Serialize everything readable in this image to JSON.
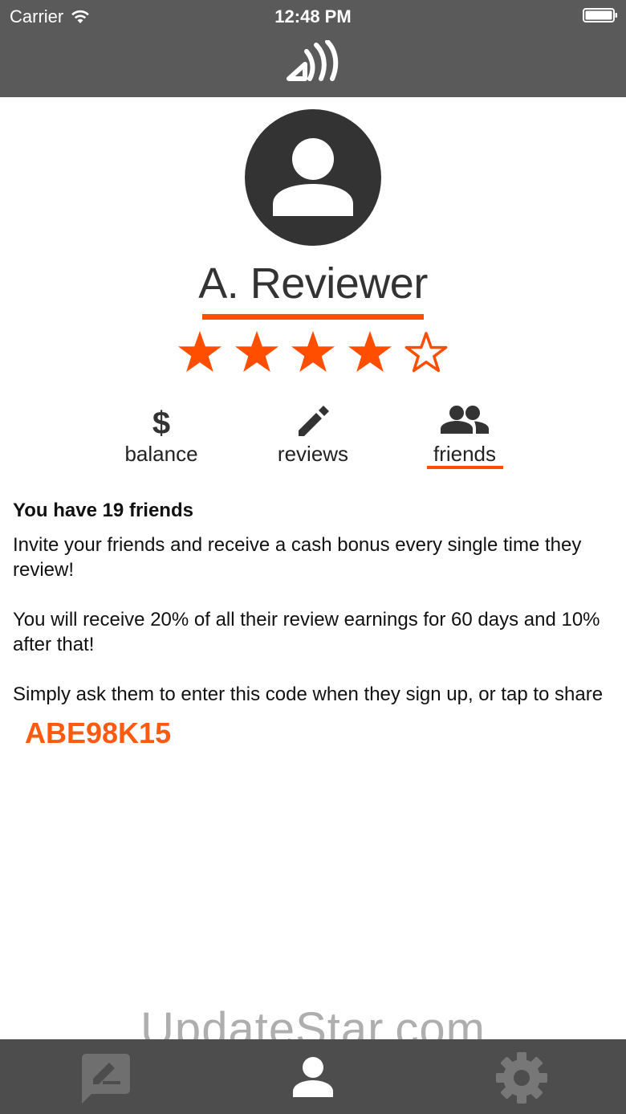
{
  "status_bar": {
    "carrier": "Carrier",
    "time": "12:48 PM"
  },
  "profile": {
    "name": "A. Reviewer",
    "rating": 4,
    "rating_max": 5
  },
  "tabs": [
    {
      "label": "balance",
      "icon": "dollar-icon",
      "selected": false
    },
    {
      "label": "reviews",
      "icon": "pencil-icon",
      "selected": false
    },
    {
      "label": "friends",
      "icon": "people-icon",
      "selected": true
    }
  ],
  "friends": {
    "title": "You have 19 friends",
    "para1": "Invite your friends and receive a cash bonus every single time they review!",
    "para2": "You will receive 20% of all their review earnings for 60 days and 10% after that!",
    "para3": "Simply ask them to enter this code when they sign up, or tap to share",
    "code": "ABE98K15"
  },
  "watermark": "UpdateStar.com",
  "bottom_nav": [
    {
      "icon": "write-review-icon"
    },
    {
      "icon": "profile-icon"
    },
    {
      "icon": "settings-gear-icon"
    }
  ],
  "colors": {
    "accent": "#ff4e00",
    "topbar": "#5a5a5a",
    "bottombar": "#4d4d4d",
    "avatar_bg": "#333333"
  }
}
